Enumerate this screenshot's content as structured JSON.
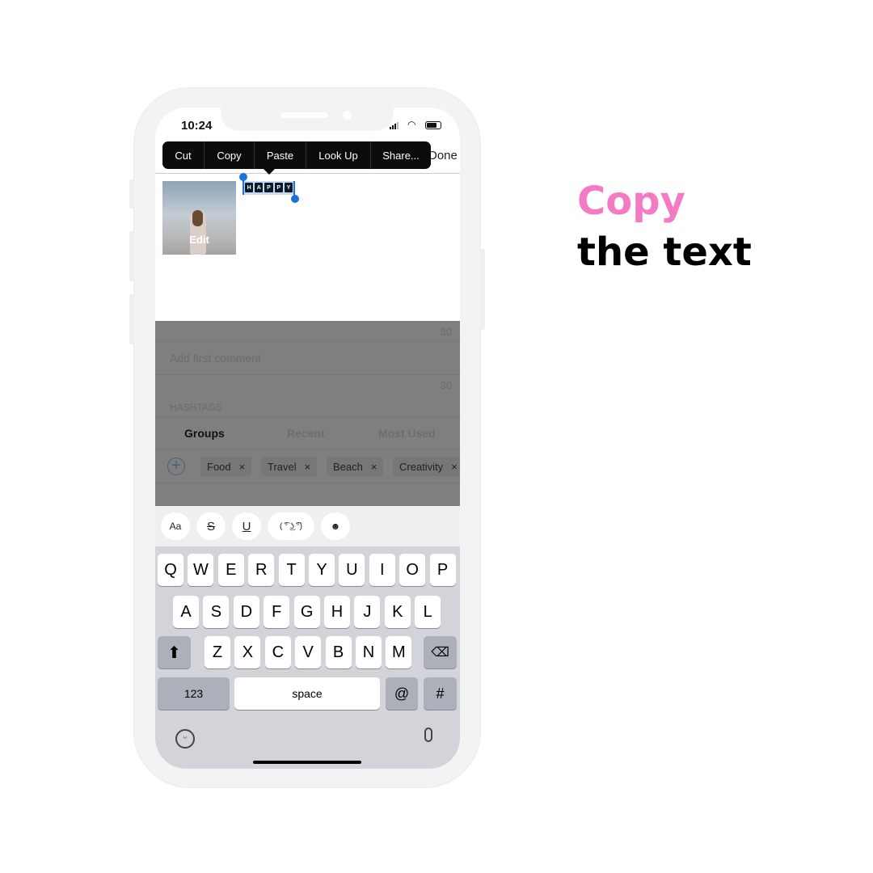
{
  "headline": {
    "line1": "Copy",
    "line2": "the text",
    "accent_color": "#f27bc4"
  },
  "status": {
    "time": "10:24"
  },
  "edit_menu": [
    "Cut",
    "Copy",
    "Paste",
    "Look Up",
    "Share..."
  ],
  "nav": {
    "done": "Done"
  },
  "post": {
    "photo_label": "Edit",
    "selected_text": [
      "H",
      "A",
      "P",
      "P",
      "Y"
    ]
  },
  "caption_count": "30",
  "first_comment": {
    "placeholder": "Add first comment",
    "count": "30"
  },
  "hashtags": {
    "label": "HASHTAGS",
    "tabs": [
      "Groups",
      "Recent",
      "Most Used"
    ],
    "active_tab": "Groups",
    "chips": [
      "Food",
      "Travel",
      "Beach",
      "Creativity"
    ]
  },
  "format_toolbar": [
    "Aa",
    "S",
    "U",
    "( ͡° ͜ʖ ͡°)",
    "☻"
  ],
  "keyboard": {
    "row1": [
      "Q",
      "W",
      "E",
      "R",
      "T",
      "Y",
      "U",
      "I",
      "O",
      "P"
    ],
    "row2": [
      "A",
      "S",
      "D",
      "F",
      "G",
      "H",
      "J",
      "K",
      "L"
    ],
    "row3": [
      "Z",
      "X",
      "C",
      "V",
      "B",
      "N",
      "M"
    ],
    "numbers": "123",
    "space": "space",
    "at": "@",
    "hash": "#"
  }
}
